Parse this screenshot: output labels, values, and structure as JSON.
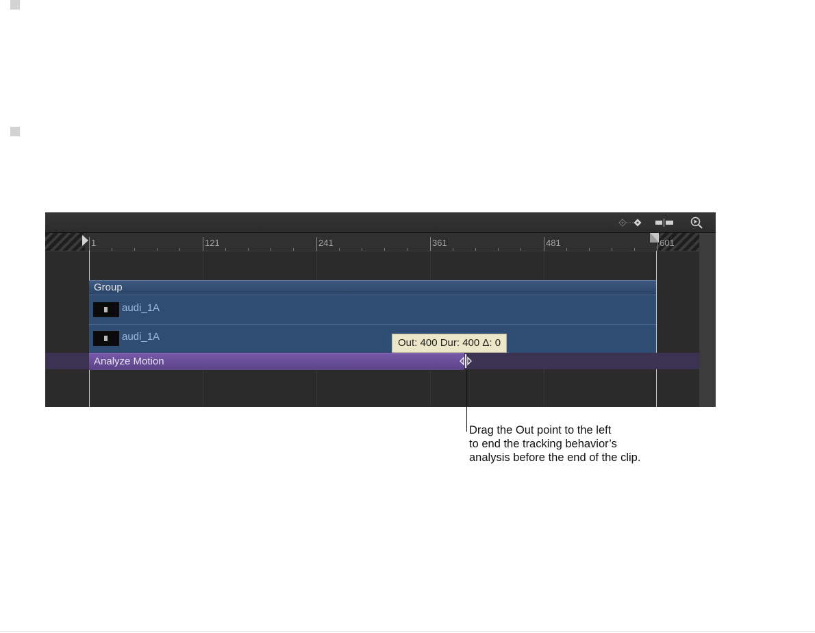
{
  "timeline": {
    "ruler_labels": [
      "1",
      "121",
      "241",
      "361",
      "481",
      "601"
    ],
    "tracks": {
      "group": "Group",
      "clips": [
        "audi_1A",
        "audi_1A"
      ],
      "behavior": "Analyze Motion"
    },
    "tooltip": "Out: 400 Dur: 400 Δ: 0",
    "icons": [
      "keyframe-icon",
      "snapping-icon",
      "zoom-icon",
      "play-range-in-icon",
      "play-range-out-icon",
      "out-point-handle-icon"
    ],
    "colors": {
      "background": "#2b2b2b",
      "clip": "#2f4d72",
      "behavior": "#6a50a0",
      "tooltip": "#ece7c8"
    }
  },
  "callout": {
    "lines": [
      "Drag the Out point to the left",
      "to end the tracking behavior’s",
      "analysis before the end of the clip."
    ]
  }
}
